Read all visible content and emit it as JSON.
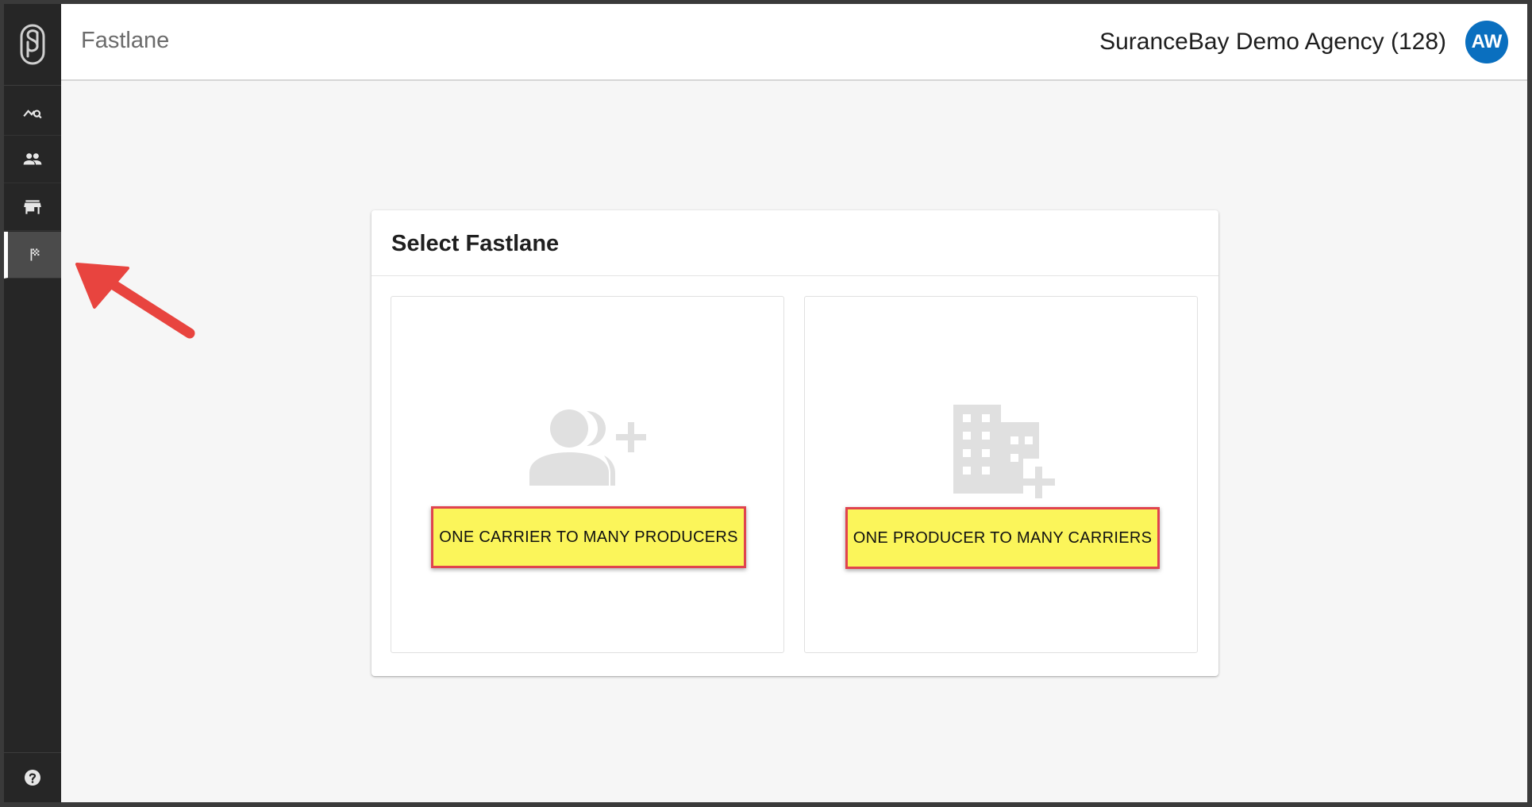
{
  "header": {
    "app_title": "Fastlane",
    "agency": "SuranceBay Demo Agency (128)",
    "avatar_initials": "AW",
    "avatar_color": "#0a6fbf"
  },
  "sidebar": {
    "logo_icon": "surancebay-logo-icon",
    "items": [
      {
        "icon": "analytics-search-icon",
        "active": false
      },
      {
        "icon": "people-icon",
        "active": false
      },
      {
        "icon": "store-icon",
        "active": false
      },
      {
        "icon": "flag-icon",
        "active": true
      }
    ],
    "help_icon": "help-icon"
  },
  "main": {
    "card_title": "Select Fastlane",
    "options": [
      {
        "label": "ONE CARRIER TO MANY PRODUCERS",
        "icon": "group-add-icon"
      },
      {
        "label": "ONE PRODUCER TO MANY CARRIERS",
        "icon": "domain-add-icon"
      }
    ]
  },
  "colors": {
    "sidebar_bg": "#262626",
    "highlight_fill": "#fbf55a",
    "highlight_border": "#e0434e",
    "annotation_arrow": "#e8443f"
  }
}
